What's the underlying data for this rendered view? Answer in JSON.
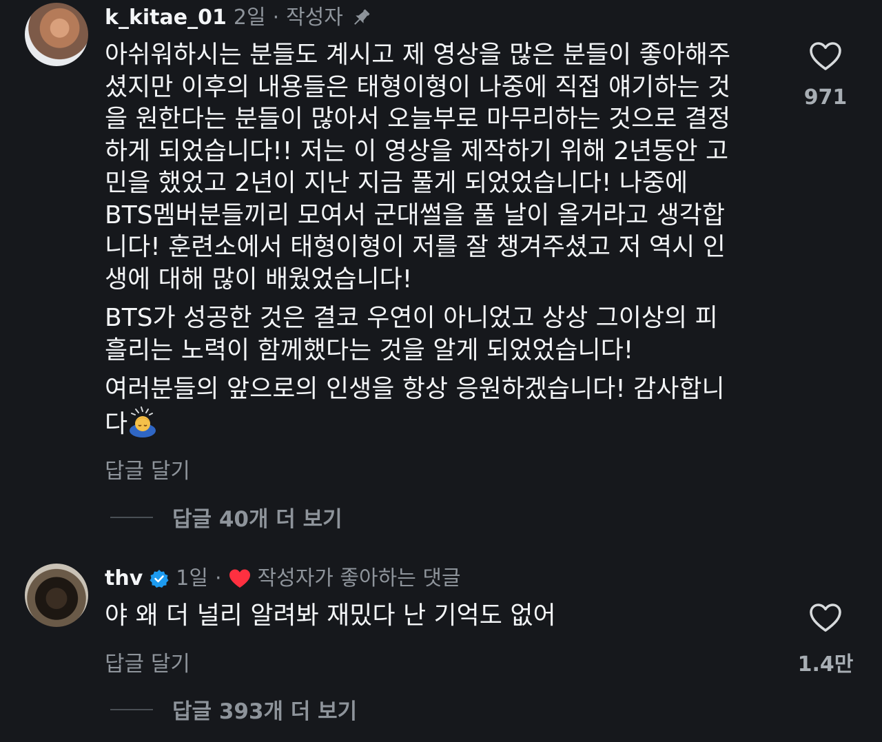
{
  "comments": [
    {
      "username": "k_kitae_01",
      "time": "2일",
      "separator": "·",
      "role": "작성자",
      "icon": "pin-icon",
      "paragraphs": [
        [
          "아쉬워하시는 분들도 계시고 제 영상을 많은 분들이 좋아해주",
          "셨지만 이후의 내용들은 태형이형이 나중에 직접 얘기하는 것",
          "을 원한다는 분들이 많아서 오늘부로 마무리하는 것으로 결정",
          "하게 되었습니다!! 저는 이 영상을 제작하기 위해 2년동안 고",
          "민을 했었고 2년이 지난 지금 풀게 되었었습니다! 나중에",
          "BTS멤버분들끼리 모여서 군대썰을 풀 날이 올거라고 생각합",
          "니다! 훈련소에서 태형이형이 저를 잘 챙겨주셨고 저 역시 인",
          "생에 대해 많이 배웠었습니다!"
        ],
        [
          "BTS가 성공한 것은 결코 우연이 아니었고 상상 그이상의 피",
          "흘리는 노력이 함께했다는 것을 알게 되었었습니다!"
        ],
        [
          "여러분들의 앞으로의 인생을 항상 응원하겠습니다! 감사합니",
          "다"
        ]
      ],
      "trailing_emoji": "bowing-person-emoji",
      "reply_label": "답글 달기",
      "view_replies": "답글 40개 더 보기",
      "like_count": "971"
    },
    {
      "username": "thv",
      "verified_icon": "verified-badge-icon",
      "time": "1일",
      "separator": "·",
      "liked_by_creator": "작성자가 좋아하는 댓글",
      "liked_icon": "red-heart-icon",
      "text": "야 왜 더 널리 알려봐 재밌다 난 기억도 없어",
      "reply_label": "답글 달기",
      "view_replies": "답글 393개 더 보기",
      "like_count": "1.4만"
    }
  ],
  "colors": {
    "background": "#16181c",
    "text": "#f3f5f7",
    "muted": "#8e949b",
    "verified": "#1d9bf0",
    "heart_red": "#ff3040"
  }
}
